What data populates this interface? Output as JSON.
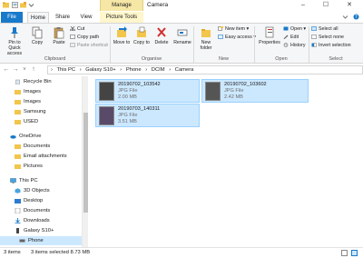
{
  "window": {
    "context_tab": "Manage",
    "title": "Camera",
    "minimize": "–",
    "maximize": "☐",
    "close": "✕"
  },
  "tabs": {
    "file": "File",
    "home": "Home",
    "share": "Share",
    "view": "View",
    "picture_tools": "Picture Tools"
  },
  "ribbon": {
    "clipboard": {
      "label": "Clipboard",
      "pin": "Pin to Quick access",
      "copy": "Copy",
      "paste": "Paste",
      "cut": "Cut",
      "copy_path": "Copy path",
      "paste_shortcut": "Paste shortcut"
    },
    "organise": {
      "label": "Organise",
      "move_to": "Move to",
      "copy_to": "Copy to",
      "delete": "Delete",
      "rename": "Rename"
    },
    "new": {
      "label": "New",
      "new_folder": "New folder",
      "new_item": "New item ▾",
      "easy_access": "Easy access ▾"
    },
    "open": {
      "label": "Open",
      "properties": "Properties",
      "open": "Open ▾",
      "edit": "Edit",
      "history": "History"
    },
    "select": {
      "label": "Select",
      "select_all": "Select all",
      "select_none": "Select none",
      "invert_selection": "Invert selection"
    }
  },
  "address": {
    "back": "←",
    "forward": "→",
    "recent": "˅",
    "up": "↑",
    "crumbs": [
      "This PC",
      "Galaxy S10+",
      "Phone",
      "DCIM",
      "Camera"
    ],
    "separator": "›"
  },
  "nav": {
    "items": [
      {
        "label": "Recycle Bin"
      },
      {
        "label": "Images"
      },
      {
        "label": "Images"
      },
      {
        "label": "Samsung"
      },
      {
        "label": "USED"
      },
      {
        "label": "OneDrive"
      },
      {
        "label": "Documents"
      },
      {
        "label": "Email attachments"
      },
      {
        "label": "Pictures"
      },
      {
        "label": "This PC"
      },
      {
        "label": "3D Objects"
      },
      {
        "label": "Desktop"
      },
      {
        "label": "Documents"
      },
      {
        "label": "Downloads"
      },
      {
        "label": "Galaxy S10+"
      },
      {
        "label": "Phone"
      }
    ]
  },
  "files": [
    {
      "name": "20190702_103542",
      "type": "JPG File",
      "size": "2.00 MB"
    },
    {
      "name": "20190702_103602",
      "type": "JPG File",
      "size": "2.42 MB"
    },
    {
      "name": "20190703_140311",
      "type": "JPG File",
      "size": "3.51 MB"
    }
  ],
  "status": {
    "item_count": "3 items",
    "selection": "3 items selected  8.73 MB"
  },
  "colors": {
    "accent": "#1979ca",
    "selection": "#cce8ff",
    "manage_tab": "#f6e7a6"
  }
}
